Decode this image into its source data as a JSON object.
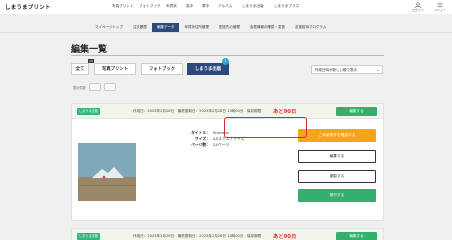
{
  "header": {
    "logo": "しまうまプリント",
    "nav": [
      "写真プリント",
      "フォトブック",
      "年賀状",
      "喪中",
      "寒中",
      "アルバム",
      "しまうま出版",
      "しまうまプラス"
    ],
    "icons": [
      {
        "name": "user-icon",
        "label": "ログイン"
      },
      {
        "name": "menu-icon",
        "label": "メニュー"
      }
    ]
  },
  "subnav": {
    "items": [
      "マイページトップ",
      "注文履歴",
      "編集データ",
      "年賀状住所管理",
      "配送先の管理",
      "会員情報の確認・変更",
      "友達招待プログラム"
    ],
    "active_index": 2
  },
  "page": {
    "title": "編集一覧"
  },
  "tabs": {
    "items": [
      "全て",
      "写真プリント",
      "フォトブック",
      "しまうま出版"
    ],
    "selected_index": 3,
    "badge": "1",
    "mini_label": "10"
  },
  "sort": {
    "value": "作成日時が新しい順で表示"
  },
  "filter": {
    "label": "表示件数",
    "pills": [
      "",
      ""
    ]
  },
  "cards": [
    {
      "status": "しまうま出版",
      "created": "作成日：2025年2月28日",
      "updated": "最終更新日：2025年2月28日 13時00分",
      "retention_label": "保存期限",
      "deadline": "あと90日",
      "edit_top": "編集する",
      "info": [
        {
          "k": "タイトル：",
          "v": "Summer"
        },
        {
          "k": "サイズ：",
          "v": "A5スクエアサイズ"
        },
        {
          "k": "ページ数：",
          "v": "24ページ"
        }
      ],
      "buttons": [
        {
          "label": "ご利用条件を確認する",
          "style": "orange"
        },
        {
          "label": "編集する",
          "style": "white"
        },
        {
          "label": "複製する",
          "style": "white"
        },
        {
          "label": "発行する",
          "style": "green"
        }
      ]
    },
    {
      "status": "しまうま出版",
      "created": "作成日：2025年2月28日",
      "updated": "最終更新日：2025年2月28日 13時00分",
      "retention_label": "保存期限",
      "deadline": "あと90日",
      "edit_top": "編集する"
    }
  ],
  "colors": {
    "accent_green": "#34b06c",
    "nav_active": "#2d4a7a",
    "deadline_red": "#d33333",
    "orange": "#f4a51c"
  }
}
